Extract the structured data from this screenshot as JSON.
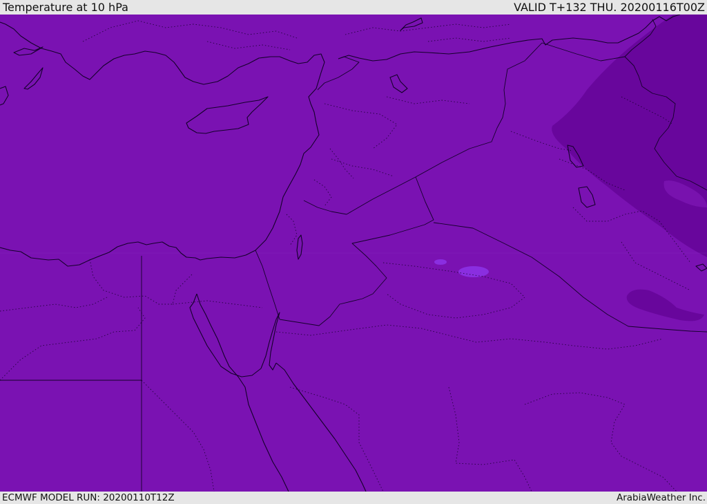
{
  "header": {
    "title": "Temperature at 10 hPa",
    "valid_time": "VALID T+132 THU. 20200116T00Z"
  },
  "footer": {
    "model_run": "ECMWF MODEL RUN: 20200110T12Z",
    "credit": "ArabiaWeather Inc."
  },
  "map": {
    "variable": "temperature",
    "level_hpa": 10,
    "colors": {
      "base_fill": "#7a12b2",
      "cold_band": "#68069c",
      "warm_spot": "#8a2ee0",
      "coastline": "#14002a"
    },
    "layers": [
      "shaded-temperature",
      "coastlines",
      "country-borders",
      "admin-boundaries"
    ]
  }
}
